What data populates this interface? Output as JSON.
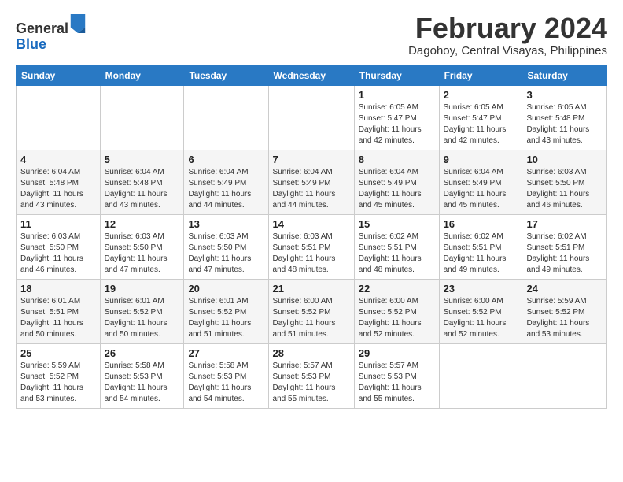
{
  "logo": {
    "general": "General",
    "blue": "Blue"
  },
  "title": "February 2024",
  "location": "Dagohoy, Central Visayas, Philippines",
  "days_header": [
    "Sunday",
    "Monday",
    "Tuesday",
    "Wednesday",
    "Thursday",
    "Friday",
    "Saturday"
  ],
  "weeks": [
    [
      {
        "day": "",
        "info": ""
      },
      {
        "day": "",
        "info": ""
      },
      {
        "day": "",
        "info": ""
      },
      {
        "day": "",
        "info": ""
      },
      {
        "day": "1",
        "info": "Sunrise: 6:05 AM\nSunset: 5:47 PM\nDaylight: 11 hours and 42 minutes."
      },
      {
        "day": "2",
        "info": "Sunrise: 6:05 AM\nSunset: 5:47 PM\nDaylight: 11 hours and 42 minutes."
      },
      {
        "day": "3",
        "info": "Sunrise: 6:05 AM\nSunset: 5:48 PM\nDaylight: 11 hours and 43 minutes."
      }
    ],
    [
      {
        "day": "4",
        "info": "Sunrise: 6:04 AM\nSunset: 5:48 PM\nDaylight: 11 hours and 43 minutes."
      },
      {
        "day": "5",
        "info": "Sunrise: 6:04 AM\nSunset: 5:48 PM\nDaylight: 11 hours and 43 minutes."
      },
      {
        "day": "6",
        "info": "Sunrise: 6:04 AM\nSunset: 5:49 PM\nDaylight: 11 hours and 44 minutes."
      },
      {
        "day": "7",
        "info": "Sunrise: 6:04 AM\nSunset: 5:49 PM\nDaylight: 11 hours and 44 minutes."
      },
      {
        "day": "8",
        "info": "Sunrise: 6:04 AM\nSunset: 5:49 PM\nDaylight: 11 hours and 45 minutes."
      },
      {
        "day": "9",
        "info": "Sunrise: 6:04 AM\nSunset: 5:49 PM\nDaylight: 11 hours and 45 minutes."
      },
      {
        "day": "10",
        "info": "Sunrise: 6:03 AM\nSunset: 5:50 PM\nDaylight: 11 hours and 46 minutes."
      }
    ],
    [
      {
        "day": "11",
        "info": "Sunrise: 6:03 AM\nSunset: 5:50 PM\nDaylight: 11 hours and 46 minutes."
      },
      {
        "day": "12",
        "info": "Sunrise: 6:03 AM\nSunset: 5:50 PM\nDaylight: 11 hours and 47 minutes."
      },
      {
        "day": "13",
        "info": "Sunrise: 6:03 AM\nSunset: 5:50 PM\nDaylight: 11 hours and 47 minutes."
      },
      {
        "day": "14",
        "info": "Sunrise: 6:03 AM\nSunset: 5:51 PM\nDaylight: 11 hours and 48 minutes."
      },
      {
        "day": "15",
        "info": "Sunrise: 6:02 AM\nSunset: 5:51 PM\nDaylight: 11 hours and 48 minutes."
      },
      {
        "day": "16",
        "info": "Sunrise: 6:02 AM\nSunset: 5:51 PM\nDaylight: 11 hours and 49 minutes."
      },
      {
        "day": "17",
        "info": "Sunrise: 6:02 AM\nSunset: 5:51 PM\nDaylight: 11 hours and 49 minutes."
      }
    ],
    [
      {
        "day": "18",
        "info": "Sunrise: 6:01 AM\nSunset: 5:51 PM\nDaylight: 11 hours and 50 minutes."
      },
      {
        "day": "19",
        "info": "Sunrise: 6:01 AM\nSunset: 5:52 PM\nDaylight: 11 hours and 50 minutes."
      },
      {
        "day": "20",
        "info": "Sunrise: 6:01 AM\nSunset: 5:52 PM\nDaylight: 11 hours and 51 minutes."
      },
      {
        "day": "21",
        "info": "Sunrise: 6:00 AM\nSunset: 5:52 PM\nDaylight: 11 hours and 51 minutes."
      },
      {
        "day": "22",
        "info": "Sunrise: 6:00 AM\nSunset: 5:52 PM\nDaylight: 11 hours and 52 minutes."
      },
      {
        "day": "23",
        "info": "Sunrise: 6:00 AM\nSunset: 5:52 PM\nDaylight: 11 hours and 52 minutes."
      },
      {
        "day": "24",
        "info": "Sunrise: 5:59 AM\nSunset: 5:52 PM\nDaylight: 11 hours and 53 minutes."
      }
    ],
    [
      {
        "day": "25",
        "info": "Sunrise: 5:59 AM\nSunset: 5:52 PM\nDaylight: 11 hours and 53 minutes."
      },
      {
        "day": "26",
        "info": "Sunrise: 5:58 AM\nSunset: 5:53 PM\nDaylight: 11 hours and 54 minutes."
      },
      {
        "day": "27",
        "info": "Sunrise: 5:58 AM\nSunset: 5:53 PM\nDaylight: 11 hours and 54 minutes."
      },
      {
        "day": "28",
        "info": "Sunrise: 5:57 AM\nSunset: 5:53 PM\nDaylight: 11 hours and 55 minutes."
      },
      {
        "day": "29",
        "info": "Sunrise: 5:57 AM\nSunset: 5:53 PM\nDaylight: 11 hours and 55 minutes."
      },
      {
        "day": "",
        "info": ""
      },
      {
        "day": "",
        "info": ""
      }
    ]
  ]
}
